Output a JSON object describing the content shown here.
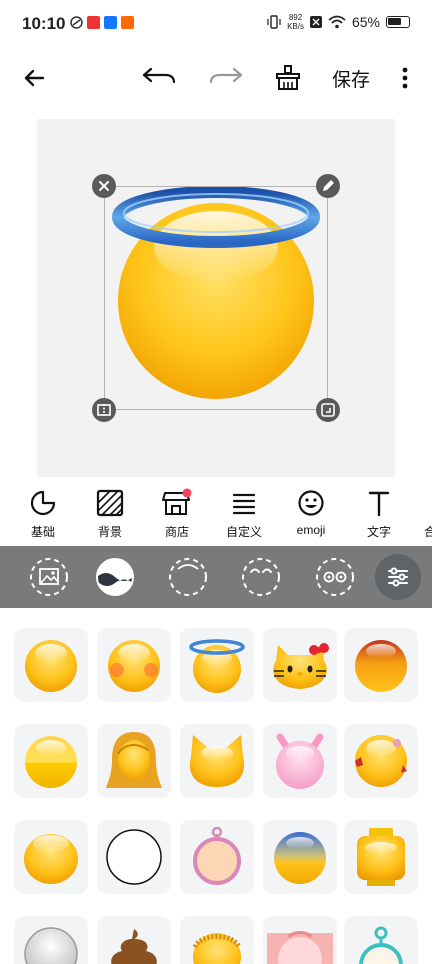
{
  "status_bar": {
    "time": "10:10",
    "net_speed_value": "892",
    "net_speed_unit": "KB/s",
    "battery": "65%"
  },
  "toolbar": {
    "back_icon": "arrow-left-icon",
    "undo_icon": "undo-icon",
    "redo_icon": "redo-icon",
    "clear_icon": "brush-clean-icon",
    "save_label": "保存",
    "more_icon": "more-vertical-icon"
  },
  "canvas": {
    "background": "#f2f2f2",
    "layer": "halo-emoji",
    "handles": [
      "close-icon",
      "edit-pencil-icon",
      "flip-icon",
      "resize-icon"
    ]
  },
  "tabs": [
    {
      "label": "基础",
      "icon": "basic-shape-icon"
    },
    {
      "label": "背景",
      "icon": "background-hatch-icon"
    },
    {
      "label": "商店",
      "icon": "store-icon",
      "badge": true
    },
    {
      "label": "自定义",
      "icon": "custom-lines-icon"
    },
    {
      "label": "emoji",
      "icon": "smiley-icon"
    },
    {
      "label": "文字",
      "icon": "text-t-icon"
    },
    {
      "label": "合",
      "icon": ""
    }
  ],
  "sub_tools": [
    "image-icon",
    "face-shape-icon",
    "outline-circle-icon",
    "eyes-closed-icon",
    "eyes-open-icon",
    "sliders-icon"
  ],
  "emoji_grid": [
    "plain-face",
    "blush-face",
    "halo-face",
    "hello-kitty-face",
    "red-top-face",
    "half-yellow-face",
    "woman-hair-face",
    "cat-face",
    "pink-devil-face",
    "spot-face",
    "glossy-face",
    "white-face",
    "ring-face",
    "blue-top-face",
    "lego-head",
    "silver-face",
    "poop-face",
    "hair-face",
    "pink-baby-face",
    "teal-antenna-face"
  ]
}
